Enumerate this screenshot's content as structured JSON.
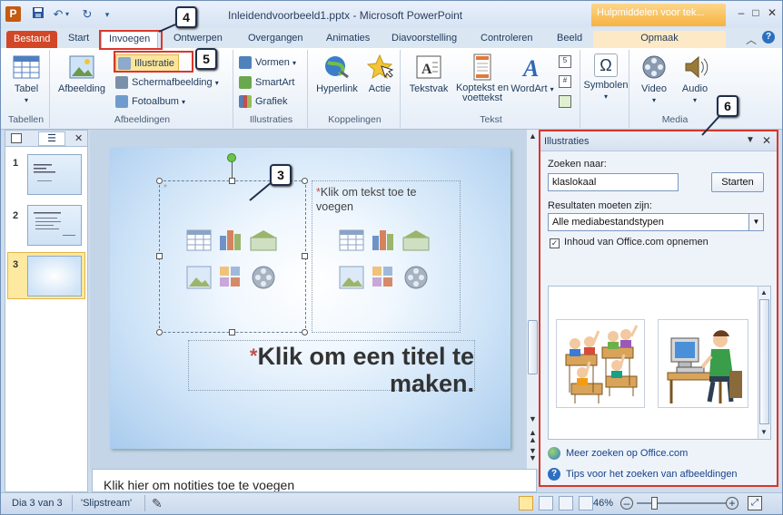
{
  "titlebar": {
    "title": "Inleidendvoorbeeld1.pptx - Microsoft PowerPoint",
    "contextual_tab": "Hulpmiddelen voor tek..."
  },
  "tabs": [
    "Bestand",
    "Start",
    "Invoegen",
    "Ontwerpen",
    "Overgangen",
    "Animaties",
    "Diavoorstelling",
    "Controleren",
    "Beeld",
    "Opmaak"
  ],
  "ribbon": {
    "tabellen": {
      "label": "Tabellen",
      "table": "Tabel"
    },
    "afbeeldingen": {
      "label": "Afbeeldingen",
      "picture": "Afbeelding",
      "clipart": "Illustratie",
      "screenshot": "Schermafbeelding",
      "album": "Fotoalbum"
    },
    "illustraties": {
      "label": "Illustraties",
      "shapes": "Vormen",
      "smartart": "SmartArt",
      "chart": "Grafiek"
    },
    "koppelingen": {
      "label": "Koppelingen",
      "hyperlink": "Hyperlink",
      "action": "Actie"
    },
    "tekst": {
      "label": "Tekst",
      "textbox": "Tekstvak",
      "header": "Koptekst en voettekst",
      "wordart": "WordArt"
    },
    "symbolen": {
      "label": "",
      "symbols": "Symbolen"
    },
    "media": {
      "label": "Media",
      "video": "Video",
      "audio": "Audio"
    }
  },
  "slides": {
    "numbers": [
      "1",
      "2",
      "3"
    ]
  },
  "slide": {
    "body_placeholder": "Klik om tekst toe te voegen",
    "title_placeholder_line1": "Klik om een titel te",
    "title_placeholder_line2": "maken."
  },
  "notes": "Klik hier om notities toe te voegen",
  "taskpane": {
    "title": "Illustraties",
    "search_label": "Zoeken naar:",
    "search_value": "klaslokaal",
    "search_button": "Starten",
    "results_label": "Resultaten moeten zijn:",
    "media_type": "Alle mediabestandstypen",
    "include_office": "Inhoud van Office.com opnemen",
    "link_more": "Meer zoeken op Office.com",
    "link_tips": "Tips voor het zoeken van afbeeldingen"
  },
  "status": {
    "slide": "Dia 3 van 3",
    "theme": "'Slipstream'",
    "zoom": "46%"
  },
  "callouts": [
    "4",
    "5",
    "3",
    "6"
  ],
  "colors": {
    "accent": "#d24726",
    "highlight": "#d9372c",
    "ribbon": "#dbe6f3"
  }
}
